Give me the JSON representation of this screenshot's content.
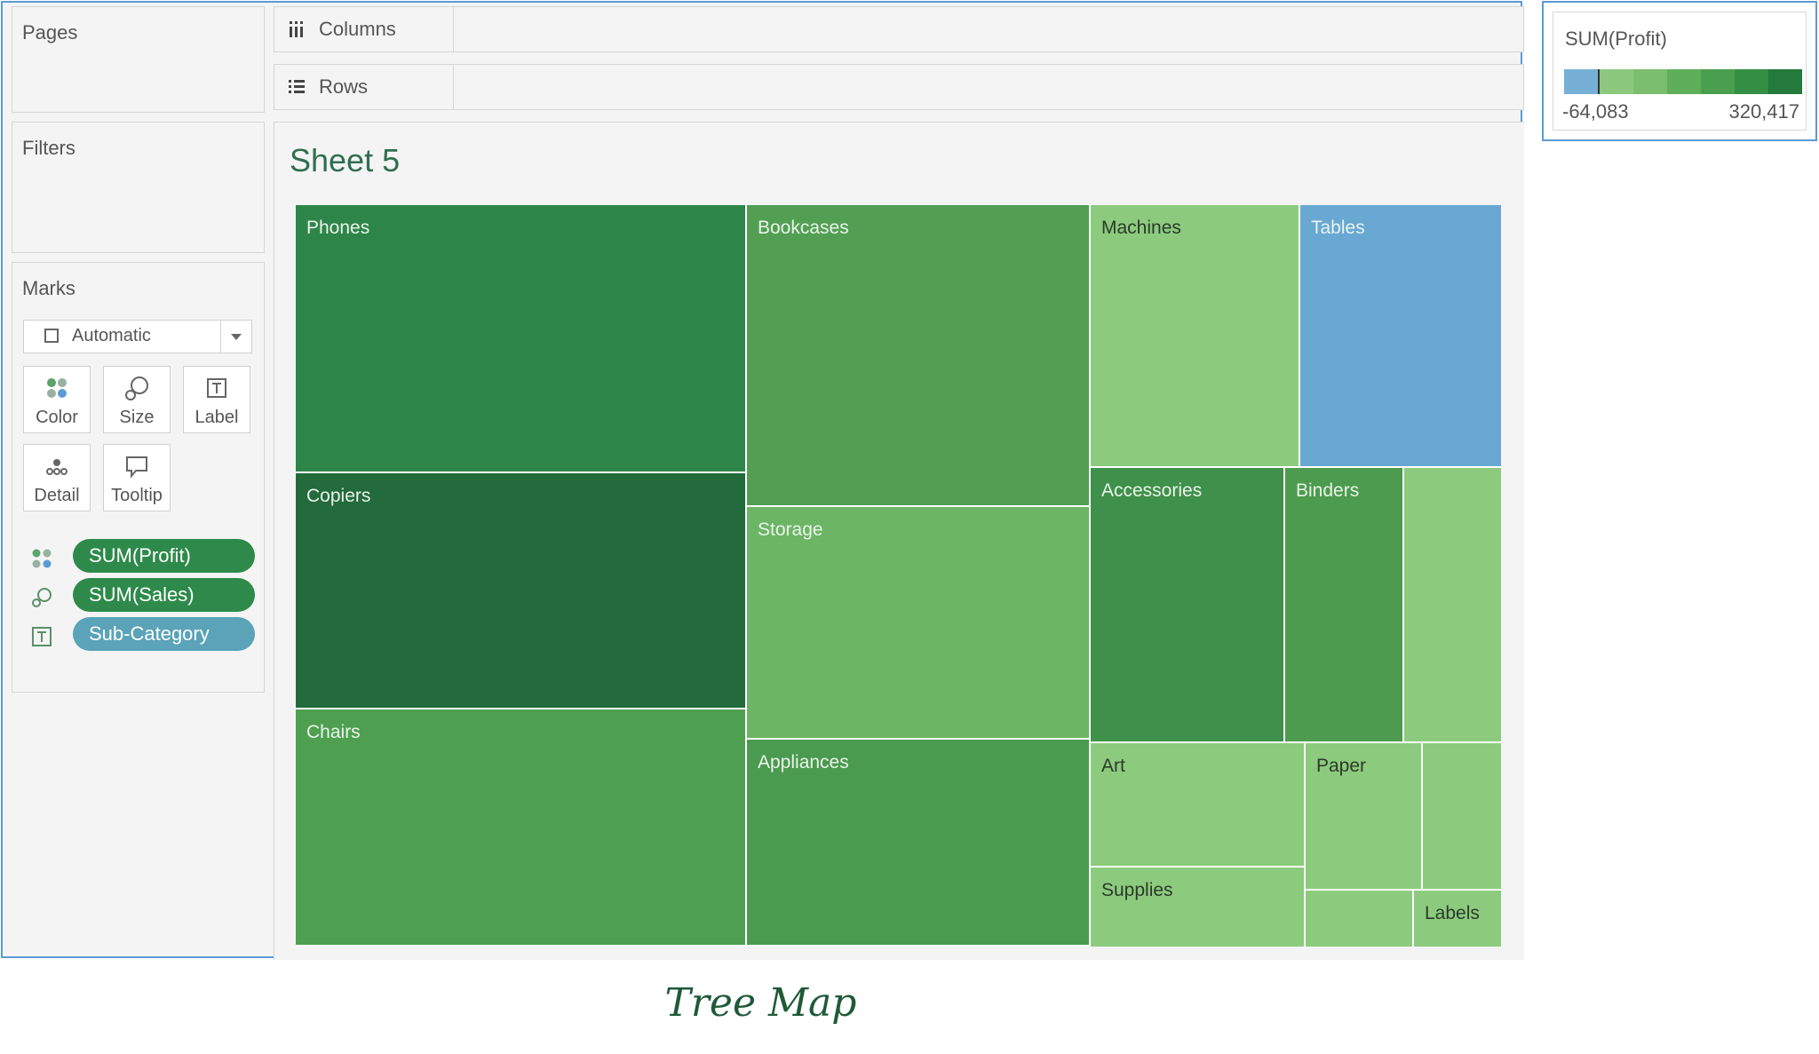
{
  "panels": {
    "pages": "Pages",
    "filters": "Filters",
    "marks": "Marks"
  },
  "shelves": {
    "columns": "Columns",
    "rows": "Rows"
  },
  "marks": {
    "type": "Automatic",
    "buttons": [
      "Color",
      "Size",
      "Label",
      "Detail",
      "Tooltip"
    ],
    "pills": [
      {
        "text": "SUM(Profit)",
        "color": "#2e8a4a",
        "icon": "color-dots-icon"
      },
      {
        "text": "SUM(Sales)",
        "color": "#2e8a4a",
        "icon": "size-icon"
      },
      {
        "text": "Sub-Category",
        "color": "#5aa3b8",
        "icon": "label-icon"
      }
    ]
  },
  "sheet": {
    "title": "Sheet 5"
  },
  "legend": {
    "title": "SUM(Profit)",
    "min": "-64,083",
    "max": "320,417",
    "colors": [
      "#76b0d6",
      "#8cc97e",
      "#7bbe6e",
      "#5fae5a",
      "#4a9f4e",
      "#348f44",
      "#237a3b"
    ]
  },
  "caption": "Tree Map",
  "chart_data": {
    "type": "treemap",
    "size_measure": "SUM(Sales)",
    "color_measure": "SUM(Profit)",
    "label_field": "Sub-Category",
    "cells": [
      {
        "label": "Phones",
        "color": "#2e8549"
      },
      {
        "label": "Copiers",
        "color": "#236a3c"
      },
      {
        "label": "Chairs",
        "color": "#4f9f51"
      },
      {
        "label": "Bookcases",
        "color": "#529f53"
      },
      {
        "label": "Storage",
        "color": "#6cb564"
      },
      {
        "label": "Appliances",
        "color": "#4a9a4f"
      },
      {
        "label": "Machines",
        "color": "#8ccb7d"
      },
      {
        "label": "Tables",
        "color": "#68a8d3"
      },
      {
        "label": "Accessories",
        "color": "#3f904a"
      },
      {
        "label": "Binders",
        "color": "#4c9b4f"
      },
      {
        "label": "",
        "color": "#8ccb7d"
      },
      {
        "label": "Art",
        "color": "#8ccb7d"
      },
      {
        "label": "Supplies",
        "color": "#8ccb7d"
      },
      {
        "label": "Paper",
        "color": "#8ccb7d"
      },
      {
        "label": "",
        "color": "#8ccb7d"
      },
      {
        "label": "",
        "color": "#8ccb7d"
      },
      {
        "label": "Labels",
        "color": "#8ccb7d"
      }
    ]
  }
}
